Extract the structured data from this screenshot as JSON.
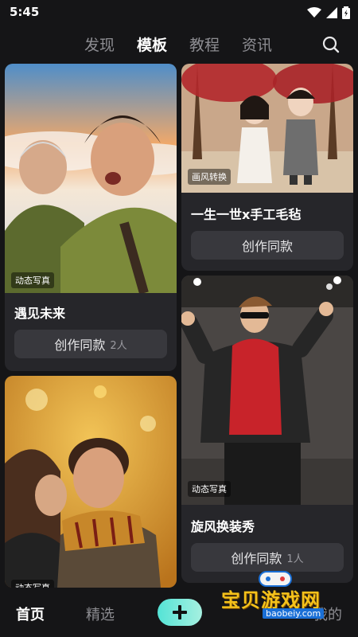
{
  "status": {
    "time": "5:45"
  },
  "top_tabs": [
    {
      "label": "发现",
      "active": false
    },
    {
      "label": "模板",
      "active": true
    },
    {
      "label": "教程",
      "active": false
    },
    {
      "label": "资讯",
      "active": false
    }
  ],
  "cards": [
    {
      "title": "遇见未来",
      "tag": "动态写真",
      "button_label": "创作同款",
      "count": "2人"
    },
    {
      "title": "一生一世x手工毛毡",
      "tag": "画风转换",
      "button_label": "创作同款",
      "count": ""
    },
    {
      "title": "旋风换装秀",
      "tag": "动态写真",
      "button_label": "创作同款",
      "count": "1人"
    },
    {
      "title": "",
      "tag": "动态写真",
      "button_label": "",
      "count": ""
    }
  ],
  "bottom_nav": [
    {
      "label": "首页",
      "active": true
    },
    {
      "label": "精选",
      "active": false
    },
    {
      "label": "我的",
      "active": false
    }
  ],
  "watermark": {
    "text": "宝贝游戏网",
    "url": "baobeiy.com"
  },
  "colors": {
    "background": "#151517",
    "card": "#26262a",
    "button": "#38383d",
    "accent": "#54e3d6"
  },
  "icons": [
    "wifi-icon",
    "signal-icon",
    "battery-icon",
    "search-icon",
    "plus-icon"
  ]
}
